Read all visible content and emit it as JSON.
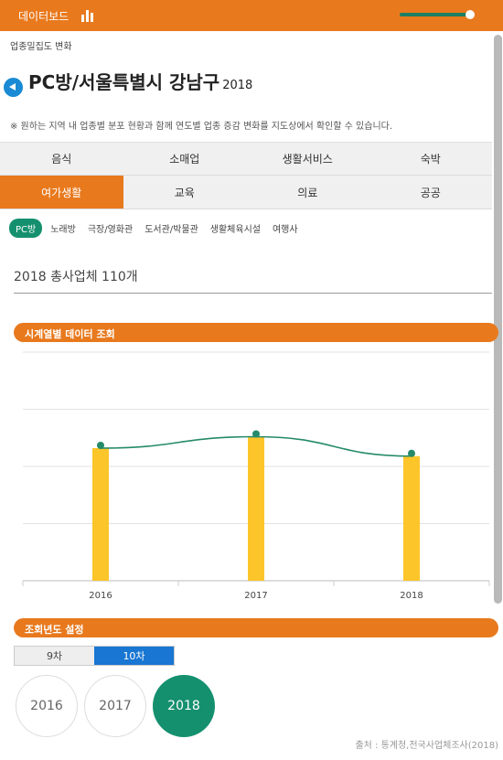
{
  "header": {
    "title": "데이터보드",
    "chart_icon": "bar-chart-icon",
    "slider_icon": "zoom-slider"
  },
  "breadcrumb": "업종밀집도 변화",
  "page": {
    "title": "PC방/서울특별시 강남구",
    "year": "2018",
    "notice": "※ 원하는 지역 내 업종별 분포 현황과 함께 연도별 업종 증감 변화를 지도상에서 확인할 수 있습니다."
  },
  "categories": {
    "row1": [
      "음식",
      "소매업",
      "생활서비스",
      "숙박"
    ],
    "row2": [
      "여가생활",
      "교육",
      "의료",
      "공공"
    ],
    "active": "여가생활"
  },
  "subtabs": [
    "PC방",
    "노래방",
    "극장/영화관",
    "도서관/박물관",
    "생활체육시설",
    "여행사"
  ],
  "summary": "2018 총사업체 110개",
  "sections": {
    "timeseries": "시계열별 데이터 조회",
    "year_setting": "조회년도 설정"
  },
  "segments": [
    "9차",
    "10차"
  ],
  "years": [
    "2016",
    "2017",
    "2018"
  ],
  "source": "출처 : 통계청,전국사업체조사(2018)",
  "colors": {
    "orange": "#e8791d",
    "green": "#15906f",
    "blue": "#1976d2",
    "bar": "#fcc52a"
  },
  "chart_data": {
    "type": "bar",
    "categories": [
      "2016",
      "2017",
      "2018"
    ],
    "series": [
      {
        "values": [
          116,
          126,
          109
        ]
      }
    ],
    "ylim": [
      0,
      200
    ],
    "grid": true,
    "overlay_line": true
  }
}
